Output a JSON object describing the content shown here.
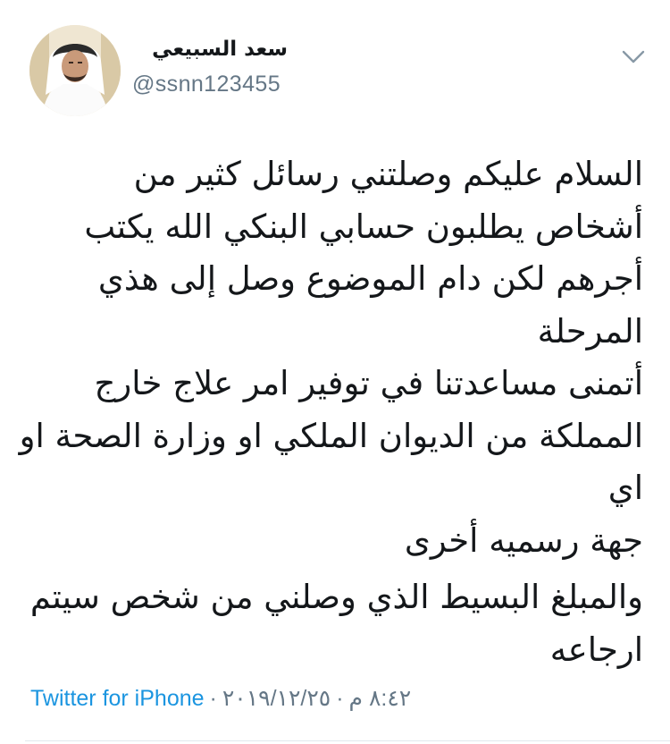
{
  "author": {
    "name": "سعد السبيعي",
    "handle": "@ssnn123455"
  },
  "tweet": {
    "paragraphs": [
      [
        "السلام عليكم وصلتني رسائل كثير من",
        "أشخاص يطلبون حسابي البنكي الله يكتب",
        "أجرهم لكن دام الموضوع وصل إلى هذي المرحلة",
        "أتمنى مساعدتنا في توفير امر علاج خارج",
        "المملكة من الديوان الملكي او وزارة الصحة او اي",
        "جهة رسميه أخرى"
      ],
      [
        "والمبلغ البسيط الذي وصلني من شخص سيتم",
        "ارجاعه"
      ]
    ]
  },
  "meta": {
    "source": "Twitter for iPhone",
    "date": "٢٠١٩/١٢/٢٥",
    "time": "٨:٤٢ م",
    "separator": "·"
  },
  "icons": {
    "menu": "chevron-down-icon"
  },
  "colors": {
    "text": "#14171a",
    "secondary": "#657786",
    "link": "#1b95e0"
  }
}
